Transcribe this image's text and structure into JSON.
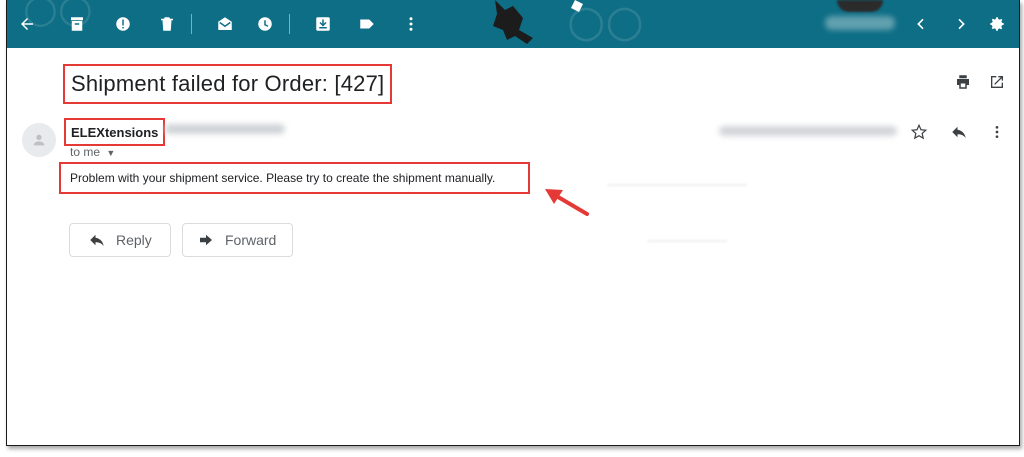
{
  "toolbar": {
    "background": "#0e6e85",
    "icons": [
      "back-arrow-icon",
      "archive-icon",
      "report-spam-icon",
      "delete-icon",
      "mark-unread-icon",
      "snooze-icon",
      "move-to-icon",
      "label-icon",
      "more-vert-icon",
      "prev-icon",
      "next-icon",
      "settings-icon"
    ]
  },
  "email": {
    "subject": "Shipment failed for Order: [427]",
    "sender_name": "ELEXtensions",
    "recipient_label": "to me",
    "body": "Problem with your shipment service. Please try to create the shipment manually."
  },
  "actions": {
    "reply_label": "Reply",
    "forward_label": "Forward"
  },
  "colors": {
    "highlight": "#e53935",
    "toolbar": "#0e6e85"
  }
}
